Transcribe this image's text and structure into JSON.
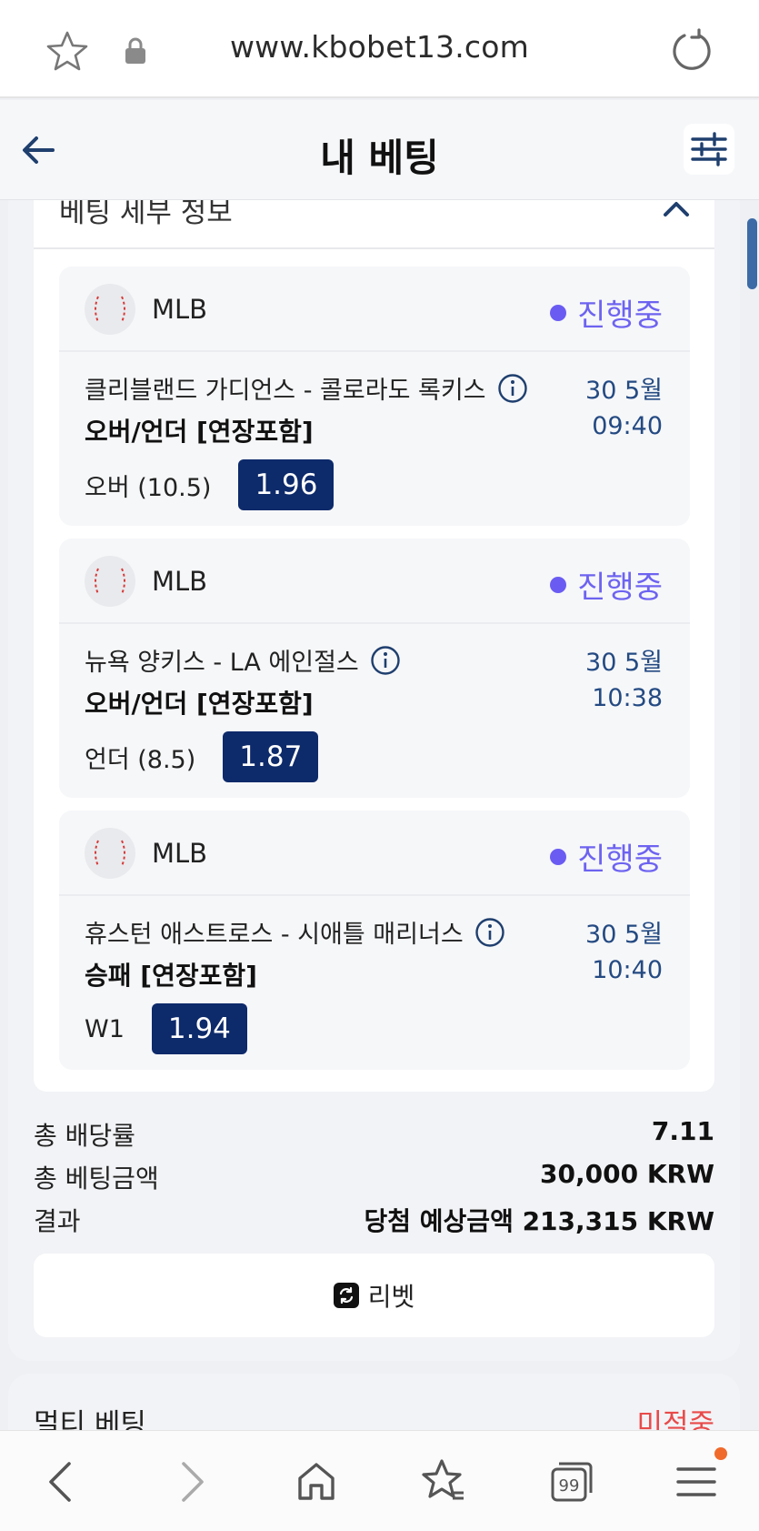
{
  "browser": {
    "url": "www.kbobet13.com"
  },
  "header": {
    "title": "내 베팅"
  },
  "details": {
    "label": "베팅 세부 정보"
  },
  "bets": [
    {
      "league": "MLB",
      "status": "진행중",
      "match": "클리블랜드 가디언스 - 콜로라도 록키스",
      "date": "30 5월",
      "time": "09:40",
      "market": "오버/언더 [연장포함]",
      "pick": "오버 (10.5)",
      "odds": "1.96"
    },
    {
      "league": "MLB",
      "status": "진행중",
      "match": "뉴욕 양키스 - LA 에인절스",
      "date": "30 5월",
      "time": "10:38",
      "market": "오버/언더 [연장포함]",
      "pick": "언더 (8.5)",
      "odds": "1.87"
    },
    {
      "league": "MLB",
      "status": "진행중",
      "match": "휴스턴 애스트로스 - 시애틀 매리너스",
      "date": "30 5월",
      "time": "10:40",
      "market": "승패 [연장포함]",
      "pick": "W1",
      "odds": "1.94"
    }
  ],
  "summary": {
    "total_odds_label": "총 배당률",
    "total_odds": "7.11",
    "total_stake_label": "총 베팅금액",
    "total_stake": "30,000 KRW",
    "result_label": "결과",
    "result": "당첨 예상금액 213,315 KRW"
  },
  "rebet": {
    "label": "리벳"
  },
  "multi": {
    "label": "멀티 베팅",
    "state": "미적중"
  },
  "colors": {
    "accent": "#0d2a6a",
    "status": "#6a5cf2",
    "lost": "#e84a4a"
  },
  "icons": [
    "star-icon",
    "lock-icon",
    "reload-icon",
    "back-arrow-icon",
    "filter-icon",
    "chevron-up-icon",
    "baseball-icon",
    "info-icon",
    "rebet-icon",
    "nav-back-icon",
    "nav-forward-icon",
    "home-icon",
    "bookmarks-icon",
    "tabs-icon",
    "menu-icon"
  ],
  "tabs_count": "99"
}
